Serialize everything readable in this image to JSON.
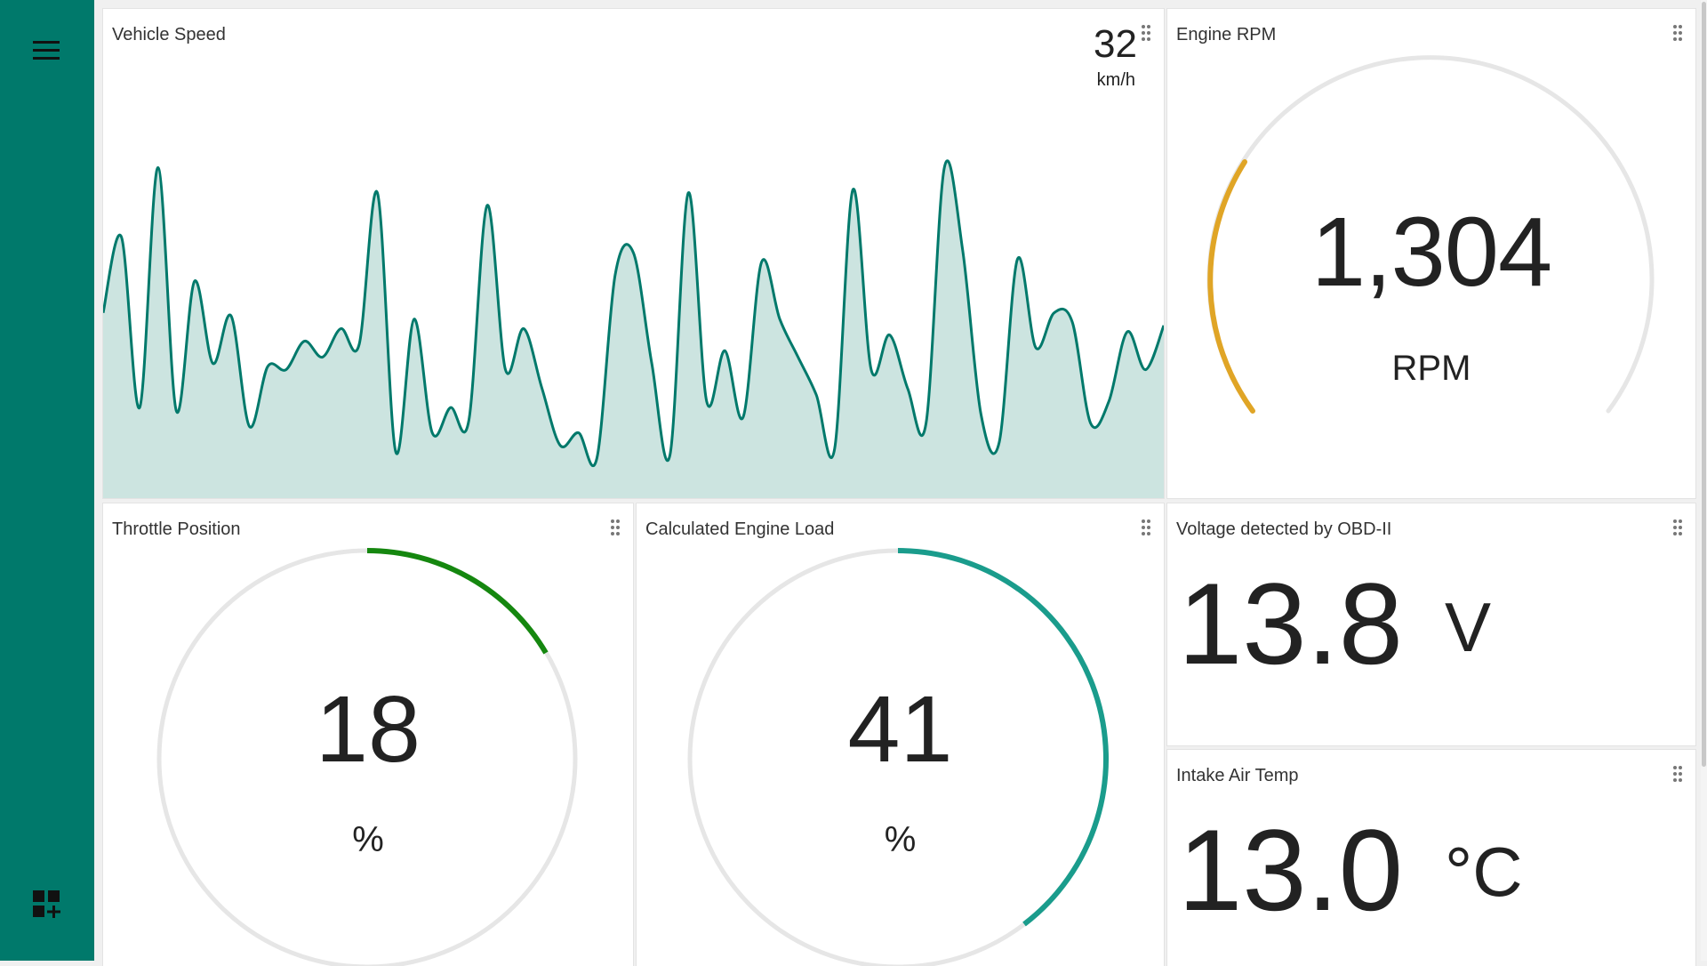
{
  "sidebar": {
    "menu_icon": "hamburger-menu-icon",
    "add_widget_icon": "dashboard-add-icon",
    "background": "#00796b"
  },
  "widgets": {
    "vehicle_speed": {
      "title": "Vehicle Speed",
      "value": "32",
      "unit": "km/h",
      "line_color": "#00796b",
      "fill_color": "#cce4e0"
    },
    "engine_rpm": {
      "title": "Engine RPM",
      "value": "1,304",
      "unit": "RPM",
      "gauge_color": "#e0a526",
      "gauge_fraction": 0.2
    },
    "throttle_position": {
      "title": "Throttle Position",
      "value": "18",
      "unit": "%",
      "gauge_color": "#15870f",
      "gauge_fraction": 0.18
    },
    "engine_load": {
      "title": "Calculated Engine Load",
      "value": "41",
      "unit": "%",
      "gauge_color": "#1a9c8c",
      "gauge_fraction": 0.41
    },
    "voltage": {
      "title": "Voltage detected by OBD-II",
      "value": "13.8",
      "unit": "V"
    },
    "intake_air_temp": {
      "title": "Intake Air Temp",
      "value": "13.0",
      "unit": "°C"
    }
  },
  "chart_data": {
    "type": "area",
    "title": "Vehicle Speed",
    "xlabel": "",
    "ylabel": "",
    "y": [
      46,
      70,
      16,
      92,
      15,
      56,
      30,
      45,
      10,
      29,
      28,
      37,
      32,
      41,
      36,
      84,
      2,
      44,
      8,
      16,
      12,
      80,
      28,
      41,
      22,
      4,
      8,
      0,
      58,
      65,
      30,
      1,
      84,
      18,
      34,
      13,
      62,
      44,
      32,
      20,
      3,
      85,
      28,
      39,
      22,
      11,
      92,
      66,
      14,
      5,
      63,
      35,
      46,
      43,
      11,
      18,
      40,
      28,
      42
    ]
  }
}
